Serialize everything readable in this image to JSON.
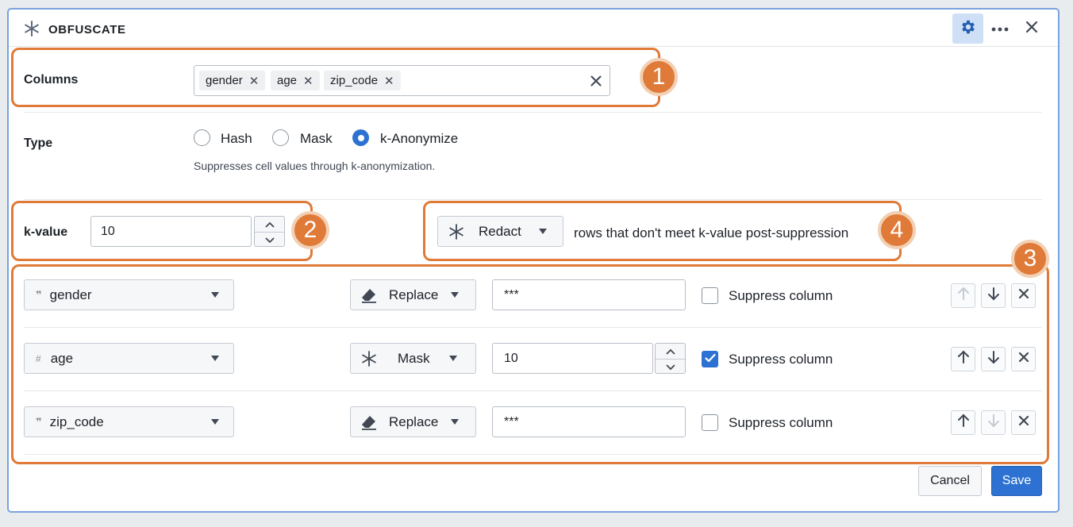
{
  "header": {
    "title": "OBFUSCATE",
    "icons": {
      "logo": "asterisk-icon",
      "settings": "gear-icon",
      "more": "more-icon",
      "close": "close-icon"
    }
  },
  "columns": {
    "label": "Columns",
    "tags": [
      "gender",
      "age",
      "zip_code"
    ]
  },
  "type": {
    "label": "Type",
    "options": [
      "Hash",
      "Mask",
      "k-Anonymize"
    ],
    "selected": "k-Anonymize",
    "helper": "Suppresses cell values through k-anonymization."
  },
  "kvalue": {
    "label": "k-value",
    "value": "10"
  },
  "redact": {
    "action": "Redact",
    "suffix": "rows that don't meet k-value post-suppression"
  },
  "rules": [
    {
      "column": "gender",
      "column_type_icon": "quote-icon",
      "method": "Replace",
      "method_icon": "eraser-icon",
      "value": "***",
      "suppress_label": "Suppress column",
      "suppress": false
    },
    {
      "column": "age",
      "column_type_icon": "hash-icon",
      "method": "Mask",
      "method_icon": "asterisk-icon",
      "value": "10",
      "suppress_label": "Suppress column",
      "suppress": true
    },
    {
      "column": "zip_code",
      "column_type_icon": "quote-icon",
      "method": "Replace",
      "method_icon": "eraser-icon",
      "value": "***",
      "suppress_label": "Suppress column",
      "suppress": false
    }
  ],
  "annotations": [
    "1",
    "2",
    "3",
    "4"
  ],
  "footer": {
    "cancel": "Cancel",
    "save": "Save"
  },
  "colors": {
    "accent": "#2d72d2",
    "annotation": "#e07a38",
    "panel_border": "#7aa3dc"
  }
}
